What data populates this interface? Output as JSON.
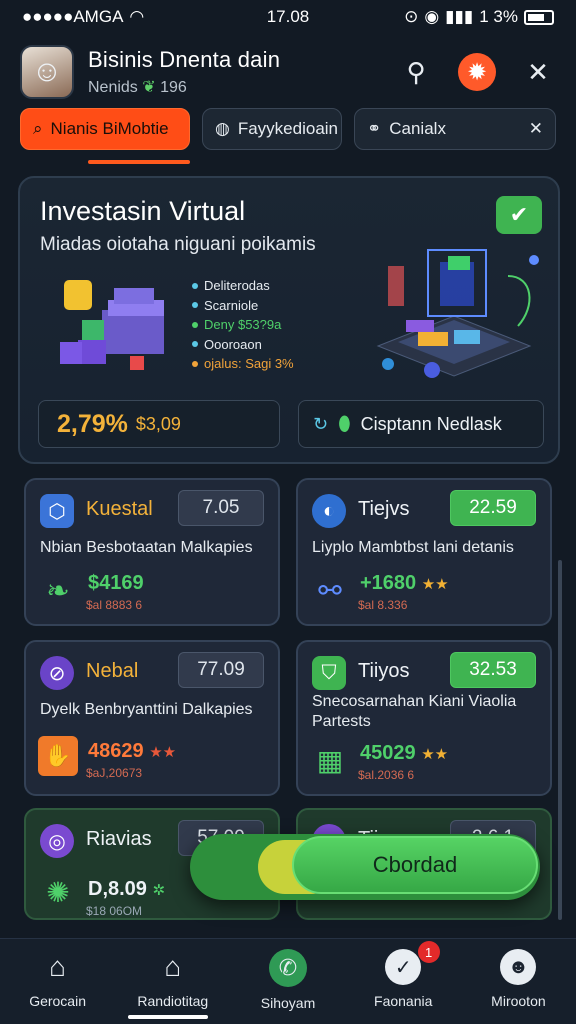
{
  "status_bar": {
    "carrier": "●●●●●AMGA",
    "time": "17.08",
    "battery": "1 3%"
  },
  "header": {
    "title": "Bisinis Dnenta dain",
    "subtitle_prefix": "Nenids",
    "subtitle_value": "196"
  },
  "chips": [
    {
      "label": "Nianis BiMobtie"
    },
    {
      "label": "Fayykedioain"
    },
    {
      "label": "Canialx"
    }
  ],
  "hero": {
    "title": "Investasin Virtual",
    "subtitle": "Miadas oiotaha niguani poikamis",
    "list": [
      {
        "text": "Deliterodas",
        "color": "#5bc8e6"
      },
      {
        "text": "Scarniole",
        "color": "#5bc8e6"
      },
      {
        "text": "Deny $53?9a",
        "color": "#4fd06a"
      },
      {
        "text": "Oooroaon",
        "color": "#5bc8e6"
      },
      {
        "text": "ojalus: Sagi 3%",
        "color": "#f0a33a"
      }
    ],
    "stat_big": "2,79%",
    "stat_small": "$3,09",
    "button_label": "Cisptann Nedlask"
  },
  "cards": [
    {
      "title": "Kuestal",
      "title_color": "#f3b23a",
      "badge": "7.05",
      "badge_green": false,
      "desc": "Nbian Besbotaatan Malkapies",
      "value": "$4169",
      "value_color": "#4fd06a",
      "sub": "$al 8883 6",
      "icon": "cube-icon"
    },
    {
      "title": "Tiejvs",
      "title_color": "#eef2f6",
      "badge": "22.59",
      "badge_green": true,
      "desc": "Liyplo Mambtbst lani detanis",
      "value": "+1680",
      "value_color": "#4fd06a",
      "sub": "$al 8.336",
      "icon": "globe-icon"
    },
    {
      "title": "Nebal",
      "title_color": "#f3b23a",
      "badge": "77.09",
      "badge_green": false,
      "desc": "Dyelk Benbryanttini Dalkapies",
      "value": "48629",
      "value_color": "#ff7a3a",
      "sub": "$aJ,20673",
      "icon": "leaf-icon"
    },
    {
      "title": "Tiiyos",
      "title_color": "#eef2f6",
      "badge": "32.53",
      "badge_green": true,
      "desc": "Snecosarnahan Kiani Viaolia Partests",
      "value": "45029",
      "value_color": "#4fd06a",
      "sub": "$al.2036 6",
      "icon": "shield-icon"
    },
    {
      "title": "Riavias",
      "title_color": "#eef2f6",
      "badge": "57.09",
      "badge_green": false,
      "desc": "",
      "value": "D,8.09",
      "value_color": "#eef2f6",
      "sub": "$18 06OM",
      "icon": "planet-icon"
    },
    {
      "title": "Tiiyus",
      "title_color": "#eef2f6",
      "badge": "2.6 1",
      "badge_green": false,
      "desc": "",
      "value": "",
      "value_color": "#eef2f6",
      "sub": "",
      "icon": "planet-icon"
    }
  ],
  "overlay_button": "Cbordad",
  "nav": [
    {
      "label": "Gerocain",
      "icon": "home-icon"
    },
    {
      "label": "Randiotitag",
      "icon": "house-icon"
    },
    {
      "label": "Sihoyam",
      "icon": "phone-icon"
    },
    {
      "label": "Faonania",
      "icon": "check-badge-icon",
      "badge": "1"
    },
    {
      "label": "Mirooton",
      "icon": "profile-icon"
    }
  ]
}
